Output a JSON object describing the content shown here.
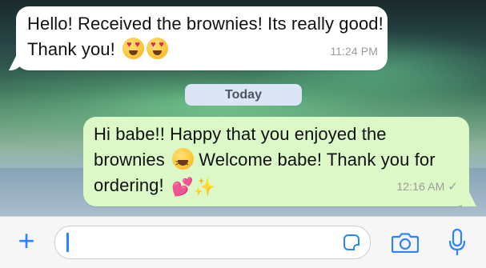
{
  "messages": {
    "incoming": {
      "text_before_emoji": "Hello! Received the brownies! Its really good! Thank you!",
      "emojis": [
        "heart-eyes-emoji",
        "heart-eyes-emoji"
      ],
      "time": "11:24 PM"
    },
    "date_divider": "Today",
    "outgoing": {
      "text_part1": "Hi babe!! Happy that you enjoyed the brownies",
      "text_part2": "Welcome babe! Thank you for ordering!",
      "emojis": [
        "laughing-emoji",
        "two-hearts-emoji",
        "sparkles-emoji"
      ],
      "time": "12:16 AM",
      "status": "✓"
    }
  },
  "composer": {
    "input_value": "",
    "icons": [
      "plus-icon",
      "sticker-icon",
      "camera-icon",
      "microphone-icon"
    ]
  },
  "colors": {
    "accent": "#2a84ff",
    "incoming_bubble": "#ffffff",
    "outgoing_bubble": "#dcf8c6",
    "timestamp": "#9b9b9b"
  }
}
